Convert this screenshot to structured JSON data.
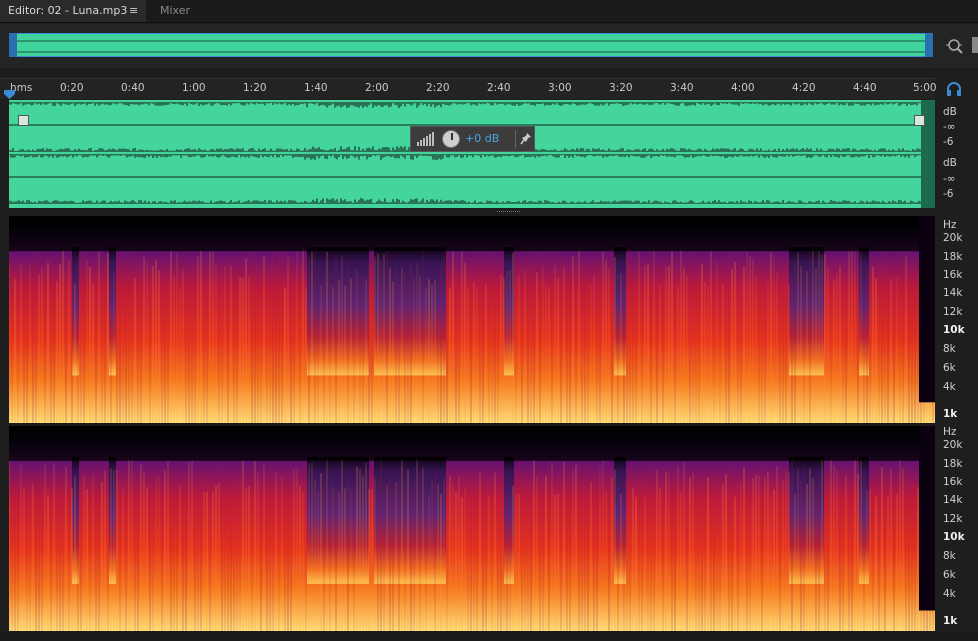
{
  "tabs": {
    "editor_label": "Editor: 02 - Luna.mp3",
    "editor_menu": "≡",
    "mixer_label": "Mixer"
  },
  "icons": {
    "zoom": "zoom-selection-icon",
    "headphones": "headphones-icon",
    "pin": "pin-icon",
    "level": "level-meter-icon",
    "playhead": "playhead-marker-icon"
  },
  "ruler": {
    "labels": [
      "hms",
      "0:20",
      "0:40",
      "1:00",
      "1:20",
      "1:40",
      "2:00",
      "2:20",
      "2:40",
      "3:00",
      "3:20",
      "3:40",
      "4:00",
      "4:20",
      "4:40",
      "5:00"
    ]
  },
  "hud": {
    "volume": "+0 dB"
  },
  "db_ruler": {
    "ch1": [
      "dB",
      "-∞",
      "-6"
    ],
    "ch2": [
      "dB",
      "-∞",
      "-6"
    ]
  },
  "hz_ruler": {
    "unit": "Hz",
    "labels": [
      "20k",
      "18k",
      "16k",
      "14k",
      "12k",
      "10k",
      "8k",
      "6k",
      "4k",
      "1k"
    ]
  },
  "colors": {
    "waveform": "#43d59b",
    "selection": "#3b8bd6",
    "hud_value": "#4aa8e0",
    "spectral_hot": "#ffd35a",
    "spectral_mid": "#e8341c",
    "spectral_low": "#3a1f6b"
  }
}
